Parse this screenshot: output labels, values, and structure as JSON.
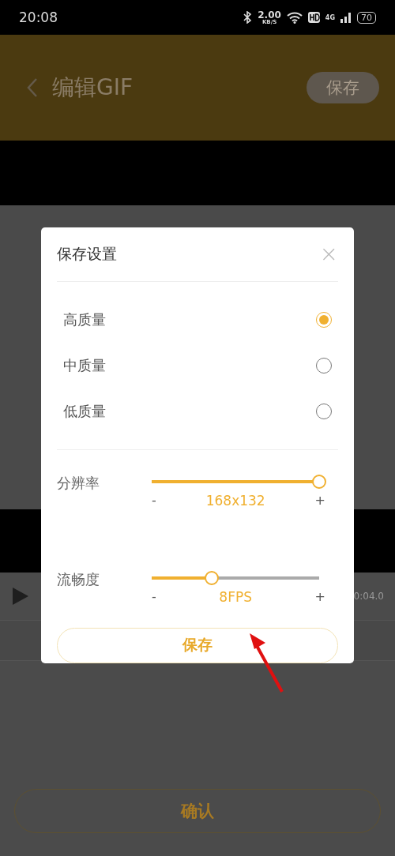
{
  "status_bar": {
    "time": "20:08",
    "speed": "2.00",
    "speed_unit": "KB/S",
    "network": "4G",
    "battery": "70"
  },
  "header": {
    "title": "编辑GIF",
    "save_button": "保存"
  },
  "player": {
    "time": "0:04.0"
  },
  "confirm_button": "确认",
  "dialog": {
    "title": "保存设置",
    "close": "×",
    "qualities": [
      {
        "label": "高质量",
        "selected": true
      },
      {
        "label": "中质量",
        "selected": false
      },
      {
        "label": "低质量",
        "selected": false
      }
    ],
    "sliders": [
      {
        "label": "分辨率",
        "level": 1,
        "minus": "-",
        "reading": "168x132",
        "plus": "+"
      },
      {
        "label": "流畅度",
        "level": 0.36,
        "minus": "-",
        "reading": "8FPS",
        "plus": "+"
      }
    ],
    "save_button": "保存"
  }
}
